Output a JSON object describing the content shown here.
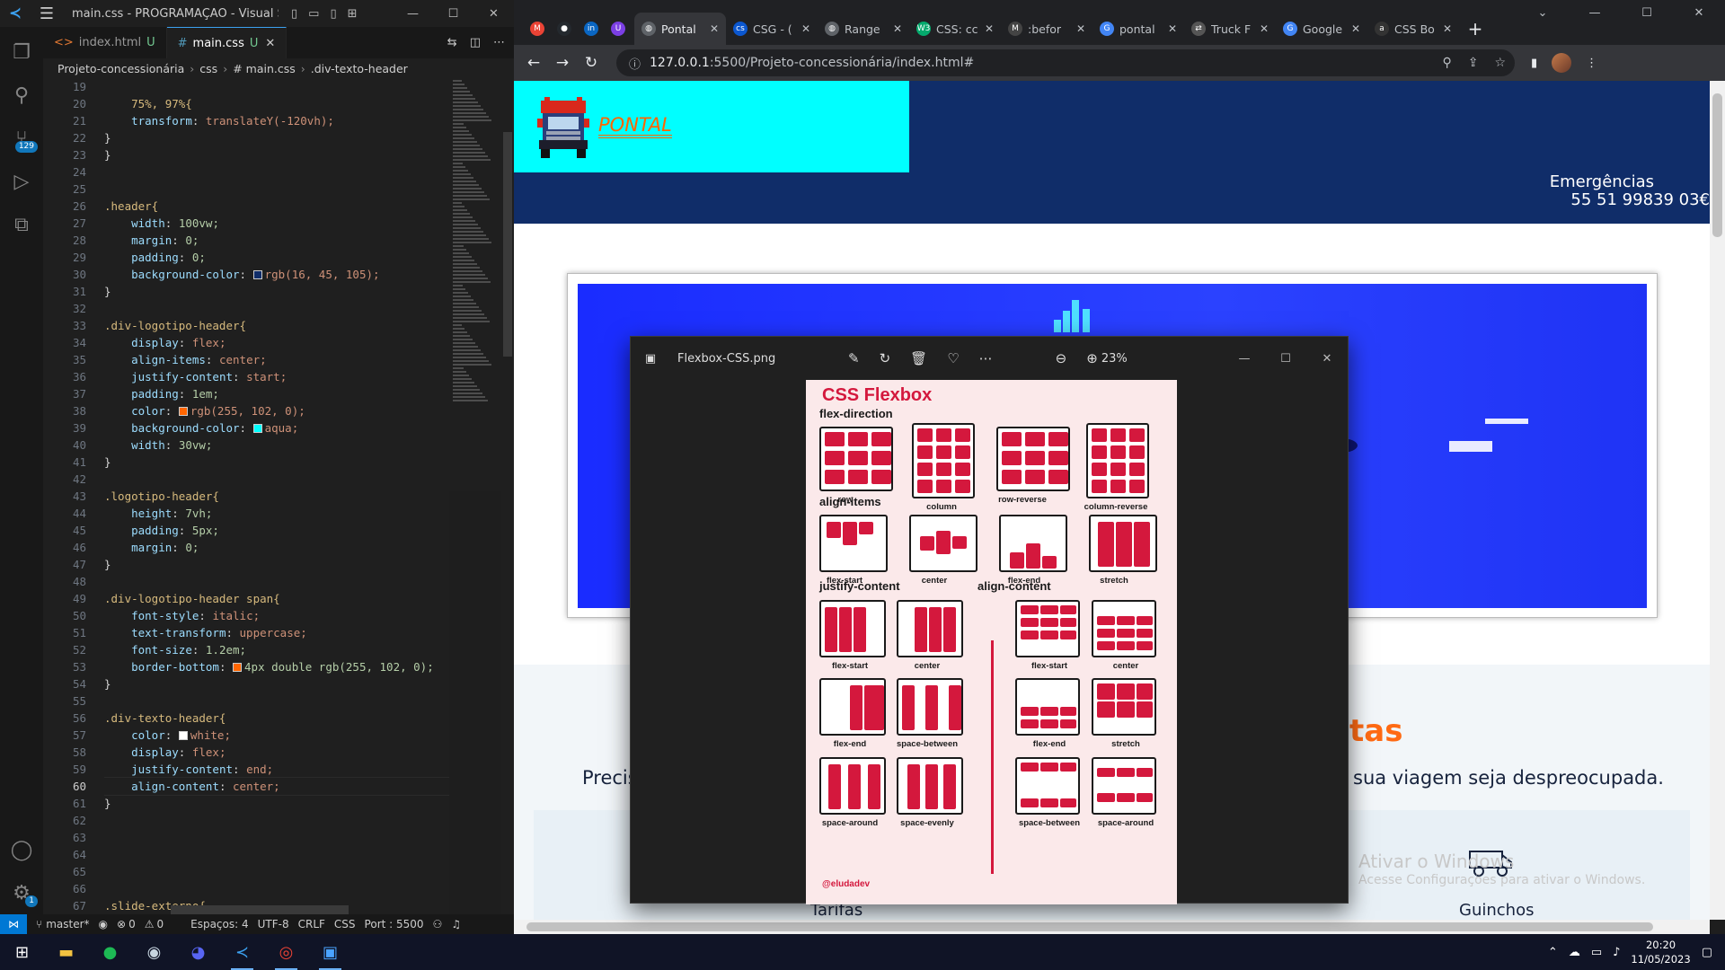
{
  "vscode": {
    "title": "main.css - PROGRAMAÇÃO - Visual Studio ...",
    "scm_badge": "129",
    "settings_badge": "1",
    "tabs": [
      {
        "label": "index.html",
        "status": "U"
      },
      {
        "label": "main.css",
        "status": "U"
      }
    ],
    "breadcrumb": [
      "Projeto-concessionária",
      "css",
      "# main.css",
      ".div-texto-header"
    ],
    "lines": [
      {
        "n": "19",
        "t": ""
      },
      {
        "n": "20",
        "t": "75%, 97%{"
      },
      {
        "n": "21",
        "t": "transform: translateY(-120vh);"
      },
      {
        "n": "22",
        "t": "}"
      },
      {
        "n": "23",
        "t": "}"
      },
      {
        "n": "24",
        "t": ""
      },
      {
        "n": "25",
        "t": ""
      },
      {
        "n": "26",
        "t": ".header{"
      },
      {
        "n": "27",
        "t": "width: 100vw;"
      },
      {
        "n": "28",
        "t": "margin: 0;"
      },
      {
        "n": "29",
        "t": "padding: 0;"
      },
      {
        "n": "30",
        "t": "background-color: rgb(16, 45, 105);"
      },
      {
        "n": "31",
        "t": "}"
      },
      {
        "n": "32",
        "t": ""
      },
      {
        "n": "33",
        "t": ".div-logotipo-header{"
      },
      {
        "n": "34",
        "t": "display: flex;"
      },
      {
        "n": "35",
        "t": "align-items: center;"
      },
      {
        "n": "36",
        "t": "justify-content: start;"
      },
      {
        "n": "37",
        "t": "padding: 1em;"
      },
      {
        "n": "38",
        "t": "color: rgb(255, 102, 0);"
      },
      {
        "n": "39",
        "t": "background-color: aqua;"
      },
      {
        "n": "40",
        "t": "width: 30vw;"
      },
      {
        "n": "41",
        "t": "}"
      },
      {
        "n": "42",
        "t": ""
      },
      {
        "n": "43",
        "t": ".logotipo-header{"
      },
      {
        "n": "44",
        "t": "height: 7vh;"
      },
      {
        "n": "45",
        "t": "padding: 5px;"
      },
      {
        "n": "46",
        "t": "margin: 0;"
      },
      {
        "n": "47",
        "t": "}"
      },
      {
        "n": "48",
        "t": ""
      },
      {
        "n": "49",
        "t": ".div-logotipo-header span{"
      },
      {
        "n": "50",
        "t": "font-style: italic;"
      },
      {
        "n": "51",
        "t": "text-transform: uppercase;"
      },
      {
        "n": "52",
        "t": "font-size: 1.2em;"
      },
      {
        "n": "53",
        "t": "border-bottom: 4px double rgb(255, 102, 0);"
      },
      {
        "n": "54",
        "t": "}"
      },
      {
        "n": "55",
        "t": ""
      },
      {
        "n": "56",
        "t": ".div-texto-header{"
      },
      {
        "n": "57",
        "t": "color: white;"
      },
      {
        "n": "58",
        "t": "display: flex;"
      },
      {
        "n": "59",
        "t": "justify-content: end;"
      },
      {
        "n": "60",
        "t": "align-content: center;"
      },
      {
        "n": "61",
        "t": "}"
      },
      {
        "n": "62",
        "t": ""
      },
      {
        "n": "63",
        "t": ""
      },
      {
        "n": "64",
        "t": ""
      },
      {
        "n": "65",
        "t": ""
      },
      {
        "n": "66",
        "t": ""
      },
      {
        "n": "67",
        "t": ".slide-externo{"
      }
    ],
    "swatches": {
      "30": "#102d69",
      "38": "#ff6600",
      "39": "#00ffff",
      "53": "#ff6600",
      "57": "#ffffff"
    },
    "current_line": "60",
    "status": {
      "branch": "master*",
      "problems": "0",
      "warnings": "0",
      "spaces": "Espaços: 4",
      "encoding": "UTF-8",
      "eol": "CRLF",
      "language": "CSS",
      "port": "Port : 5500"
    }
  },
  "browser": {
    "tabs": [
      {
        "label": "",
        "icon": "gmail-icon",
        "color": "#ea4335",
        "glyph": "M"
      },
      {
        "label": "",
        "icon": "github-icon",
        "color": "#24292e",
        "glyph": "●"
      },
      {
        "label": "",
        "icon": "linkedin-icon",
        "color": "#0a66c2",
        "glyph": "in"
      },
      {
        "label": "",
        "icon": "extension-icon",
        "color": "#7b3fe4",
        "glyph": "U"
      },
      {
        "label": "Pontal",
        "icon": "globe-icon",
        "color": "#5f6368",
        "glyph": "◍",
        "active": true
      },
      {
        "label": "CSG - (",
        "icon": "csg-icon",
        "color": "#0b57d0",
        "glyph": "cs"
      },
      {
        "label": "Range",
        "icon": "globe-icon",
        "color": "#5f6368",
        "glyph": "◍"
      },
      {
        "label": "CSS: cc",
        "icon": "w3schools-icon",
        "color": "#04aa6d",
        "glyph": "W3"
      },
      {
        "label": ":befor",
        "icon": "mdn-icon",
        "color": "#444",
        "glyph": "M"
      },
      {
        "label": "pontal",
        "icon": "google-icon",
        "color": "#4285f4",
        "glyph": "G"
      },
      {
        "label": "Truck F",
        "icon": "truck-site-icon",
        "color": "#555",
        "glyph": "⇄"
      },
      {
        "label": "Google",
        "icon": "google-translate-icon",
        "color": "#4285f4",
        "glyph": "G"
      },
      {
        "label": "CSS Bo",
        "icon": "site-icon",
        "color": "#333",
        "glyph": "a"
      }
    ],
    "url_host": "127.0.0.1",
    "url_path": ":5500/Projeto-concessionária/index.html#",
    "page": {
      "brand": "PONTAL",
      "emergency_label": "Emergências",
      "emergency_phone": "55 51 99839 03€",
      "heading_right": "tas",
      "body_left": "Precis",
      "body_right": "sua viagem seja despreocupada.",
      "card1": "Tarifas",
      "card2": "Guinchos",
      "watermark_title": "Ativar o Windows",
      "watermark_sub": "Acesse Configurações para ativar o Windows."
    }
  },
  "photos": {
    "filename": "Flexbox-CSS.png",
    "zoom": "23%",
    "poster": {
      "title": "CSS Flexbox",
      "s1": "flex-direction",
      "s1_items": [
        "row",
        "column",
        "row-reverse",
        "column-reverse"
      ],
      "s2": "align-items",
      "s2_items": [
        "flex-start",
        "center",
        "flex-end",
        "stretch"
      ],
      "s3": "justify-content",
      "s3_items": [
        "flex-start",
        "center",
        "flex-end",
        "space-between",
        "space-around",
        "space-evenly"
      ],
      "s4": "align-content",
      "s4_items": [
        "flex-start",
        "center",
        "flex-end",
        "stretch",
        "space-between",
        "space-around"
      ],
      "handle": "@eludadev"
    }
  },
  "taskbar": {
    "apps": [
      {
        "name": "windows-start-icon",
        "glyph": "⊞",
        "color": "#ffffff"
      },
      {
        "name": "file-explorer-icon",
        "glyph": "▬",
        "color": "#f3c341"
      },
      {
        "name": "spotify-icon",
        "glyph": "●",
        "color": "#1db954"
      },
      {
        "name": "steam-icon",
        "glyph": "◉",
        "color": "#c7d5e0"
      },
      {
        "name": "discord-icon",
        "glyph": "◕",
        "color": "#5865f2"
      },
      {
        "name": "vscode-icon",
        "glyph": "≺",
        "color": "#3ca1f0",
        "active": true
      },
      {
        "name": "chrome-icon",
        "glyph": "◎",
        "color": "#ea4335",
        "active": true
      },
      {
        "name": "photos-icon",
        "glyph": "▣",
        "color": "#4aa3ff",
        "active": true
      }
    ],
    "time": "20:20",
    "date": "11/05/2023"
  }
}
